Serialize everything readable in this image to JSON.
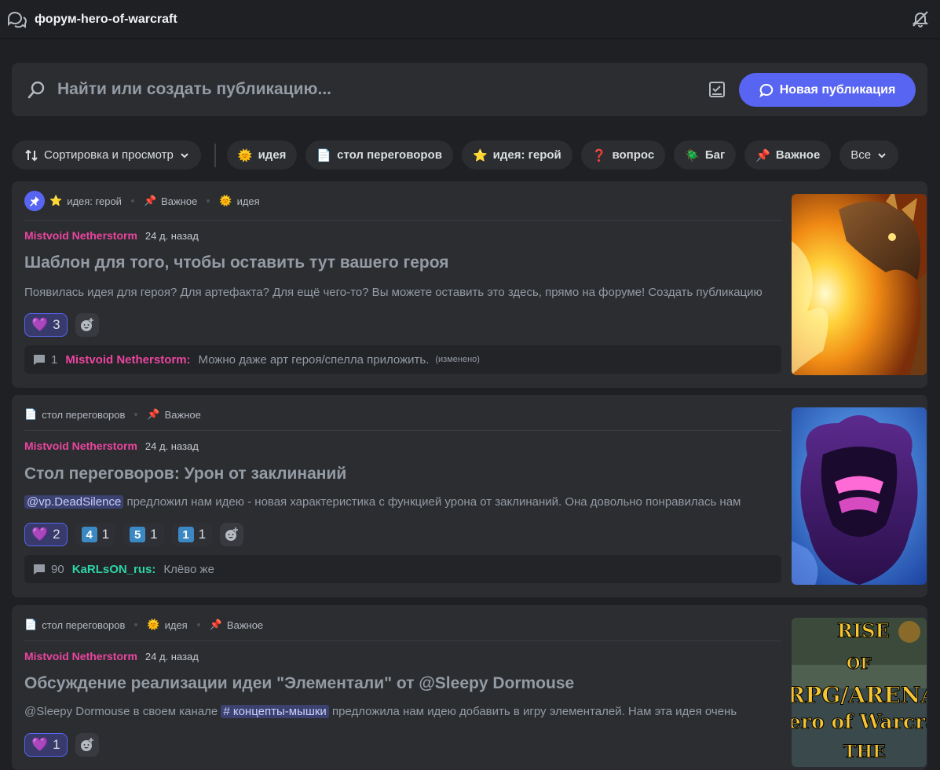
{
  "header": {
    "title": "форум-hero-of-warcraft"
  },
  "search": {
    "placeholder": "Найти или создать публикацию...",
    "new_post_label": "Новая публикация"
  },
  "filters": {
    "sort_label": "Сортировка и просмотр",
    "tags": [
      {
        "icon": "sun-emoji",
        "label": "идея"
      },
      {
        "icon": "page-emoji",
        "label": "стол переговоров"
      },
      {
        "icon": "star-emoji",
        "label": "идея: герой"
      },
      {
        "icon": "question-emoji",
        "label": "вопрос"
      },
      {
        "icon": "bug-emoji",
        "label": "Баг"
      },
      {
        "icon": "pushpin-emoji",
        "label": "Важное"
      }
    ],
    "all_label": "Все"
  },
  "posts": [
    {
      "tags": [
        "идея: герой",
        "Важное",
        "идея"
      ],
      "author": "Mistvoid Netherstorm",
      "time": "24 д. назад",
      "title": "Шаблон для того, чтобы оставить тут вашего героя",
      "snippet": "Появилась идея для героя? Для артефакта? Для ещё чего-то? Вы можете оставить это здесь, прямо на форуме! Создать публикацию",
      "reactions": [
        {
          "emoji": "purple-heart",
          "count": "3"
        }
      ],
      "reply": {
        "count": "1",
        "author": "Mistvoid Netherstorm:",
        "author_color": "#eb459f",
        "text": "Можно даже арт героя/спелла приложить.",
        "edited": "(изменено)"
      }
    },
    {
      "tags": [
        "стол переговоров",
        "Важное"
      ],
      "author": "Mistvoid Netherstorm",
      "time": "24 д. назад",
      "title": "Стол переговоров: Урон от заклинаний",
      "mention": "@vp.DeadSilence",
      "snippet": " предложил нам идею - новая характеристика с функцией урона от заклинаний. Она довольно понравилась нам",
      "reactions": [
        {
          "emoji": "purple-heart",
          "count": "2"
        },
        {
          "emoji": "keycap",
          "key": "4",
          "count": "1"
        },
        {
          "emoji": "keycap",
          "key": "5",
          "count": "1"
        },
        {
          "emoji": "keycap",
          "key": "1",
          "count": "1"
        }
      ],
      "reply": {
        "count": "90",
        "author": "KaRLsON_rus:",
        "author_color": "#2dd4a7",
        "text": "Клёво же"
      }
    },
    {
      "tags": [
        "стол переговоров",
        "идея",
        "Важное"
      ],
      "author": "Mistvoid Netherstorm",
      "time": "24 д. назад",
      "title": "Обсуждение реализации идеи \"Элементали\" от @Sleepy Dormouse",
      "snippet_before": "@Sleepy Dormouse в своем канале ",
      "channel": "# концепты-мышки",
      "snippet": " предложила нам идею добавить в игру элементалей. Нам эта идея очень",
      "reactions": [
        {
          "emoji": "purple-heart",
          "count": "1"
        }
      ],
      "thumb_text": [
        "RISE",
        "OF",
        "RPG/ARENA",
        "ero of Warcra",
        "THE"
      ]
    }
  ]
}
